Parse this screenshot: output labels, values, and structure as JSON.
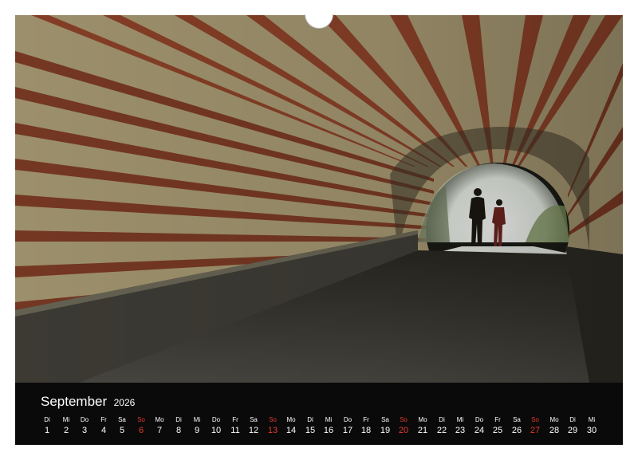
{
  "calendar": {
    "month": "September",
    "year": "2026",
    "accent_color": "#e23a2e",
    "days": [
      {
        "wd": "Di",
        "d": "1"
      },
      {
        "wd": "Mi",
        "d": "2"
      },
      {
        "wd": "Do",
        "d": "3"
      },
      {
        "wd": "Fr",
        "d": "4"
      },
      {
        "wd": "Sa",
        "d": "5"
      },
      {
        "wd": "So",
        "d": "6"
      },
      {
        "wd": "Mo",
        "d": "7"
      },
      {
        "wd": "Di",
        "d": "8"
      },
      {
        "wd": "Mi",
        "d": "9"
      },
      {
        "wd": "Do",
        "d": "10"
      },
      {
        "wd": "Fr",
        "d": "11"
      },
      {
        "wd": "Sa",
        "d": "12"
      },
      {
        "wd": "So",
        "d": "13"
      },
      {
        "wd": "Mo",
        "d": "14"
      },
      {
        "wd": "Di",
        "d": "15"
      },
      {
        "wd": "Mi",
        "d": "16"
      },
      {
        "wd": "Do",
        "d": "17"
      },
      {
        "wd": "Fr",
        "d": "18"
      },
      {
        "wd": "Sa",
        "d": "19"
      },
      {
        "wd": "So",
        "d": "20"
      },
      {
        "wd": "Mo",
        "d": "21"
      },
      {
        "wd": "Di",
        "d": "22"
      },
      {
        "wd": "Mi",
        "d": "23"
      },
      {
        "wd": "Do",
        "d": "24"
      },
      {
        "wd": "Fr",
        "d": "25"
      },
      {
        "wd": "Sa",
        "d": "26"
      },
      {
        "wd": "So",
        "d": "27"
      },
      {
        "wd": "Mo",
        "d": "28"
      },
      {
        "wd": "Di",
        "d": "29"
      },
      {
        "wd": "Mi",
        "d": "30"
      }
    ]
  }
}
